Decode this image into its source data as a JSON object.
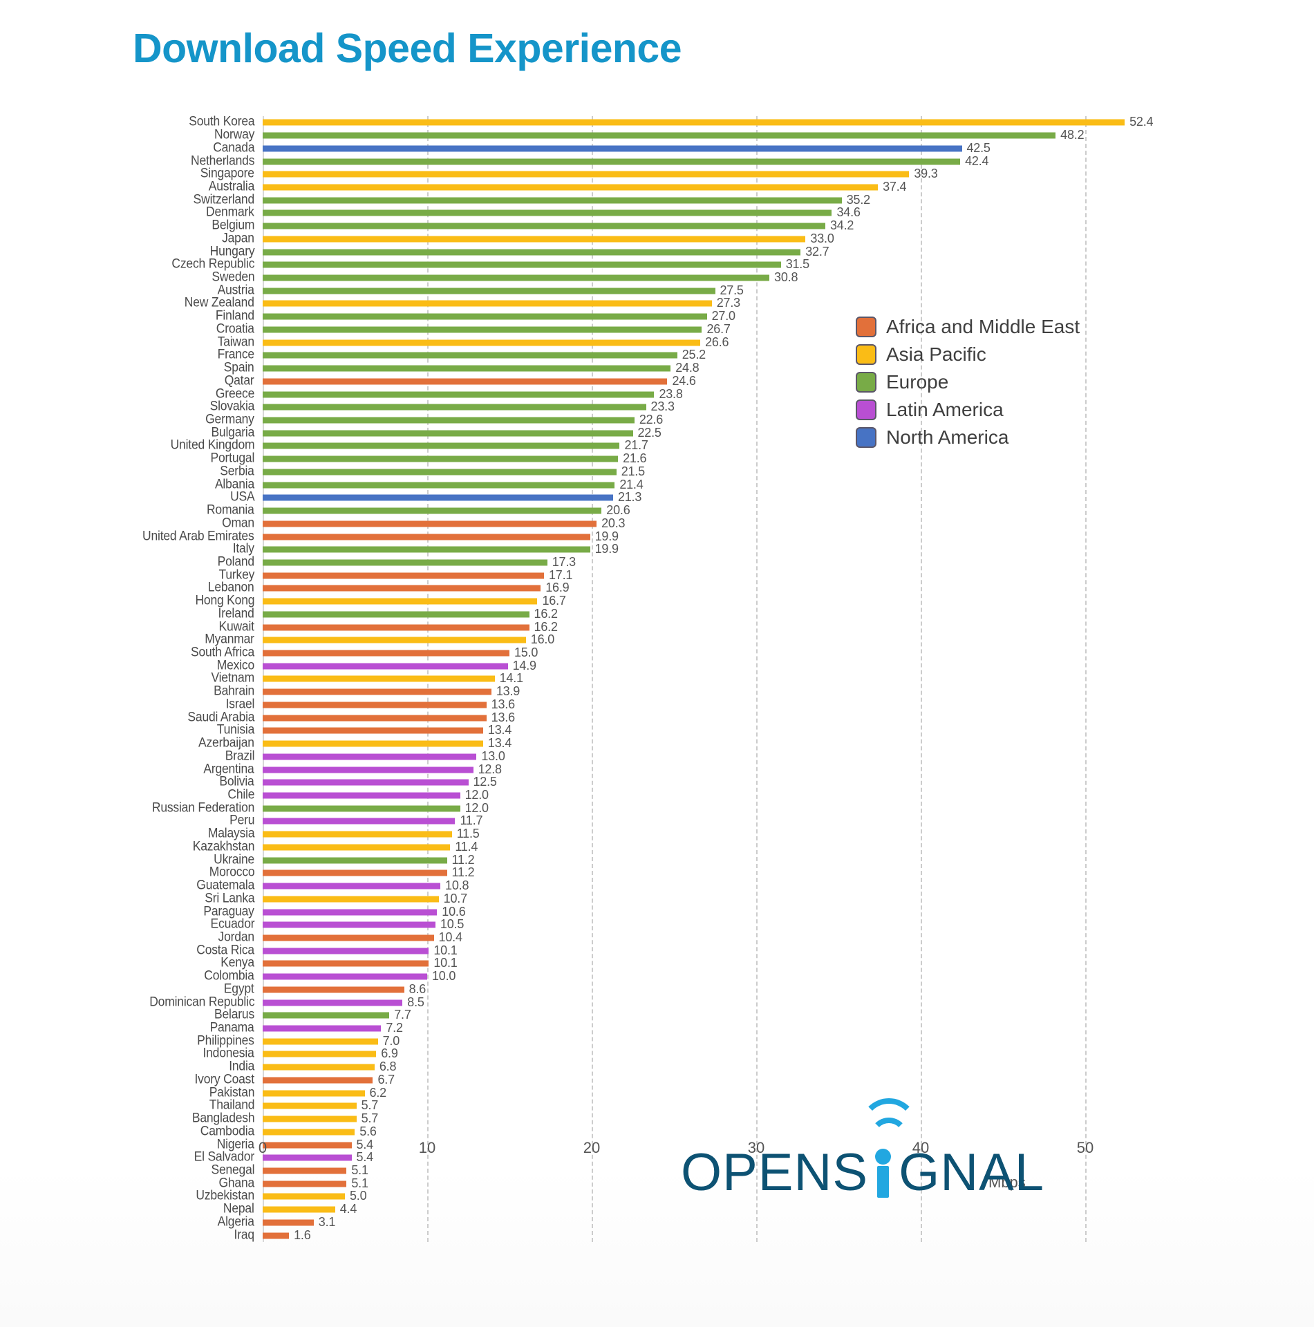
{
  "title": "Download Speed Experience",
  "axis": {
    "unit_label": "Mbps",
    "ticks": [
      0,
      10,
      20,
      30,
      40,
      50
    ],
    "max": 50
  },
  "legend": {
    "items": [
      {
        "label": "Africa and Middle East",
        "color": "#E2703A"
      },
      {
        "label": "Asia Pacific",
        "color": "#FABC16"
      },
      {
        "label": "Europe",
        "color": "#78AB47"
      },
      {
        "label": "Latin America",
        "color": "#B94FD3"
      },
      {
        "label": "North America",
        "color": "#4773C4"
      }
    ]
  },
  "logo": {
    "part1": "OPENS",
    "part2": "GNAL",
    "brand_dark": "#0d5273",
    "brand_light": "#22a7e0"
  },
  "chart_data": {
    "type": "bar",
    "orientation": "horizontal",
    "title": "Download Speed Experience",
    "xlabel": "Mbps",
    "ylabel": "",
    "xlim": [
      0,
      50
    ],
    "grid": "vertical-dashed",
    "legend_position": "right-middle",
    "legend_entries": [
      "Africa and Middle East",
      "Asia Pacific",
      "Europe",
      "Latin America",
      "North America"
    ],
    "region_colors": {
      "Africa and Middle East": "#E2703A",
      "Asia Pacific": "#FABC16",
      "Europe": "#78AB47",
      "Latin America": "#B94FD3",
      "North America": "#4773C4"
    },
    "categories": [
      "South Korea",
      "Norway",
      "Canada",
      "Netherlands",
      "Singapore",
      "Australia",
      "Switzerland",
      "Denmark",
      "Belgium",
      "Japan",
      "Hungary",
      "Czech Republic",
      "Sweden",
      "Austria",
      "New Zealand",
      "Finland",
      "Croatia",
      "Taiwan",
      "France",
      "Spain",
      "Qatar",
      "Greece",
      "Slovakia",
      "Germany",
      "Bulgaria",
      "United Kingdom",
      "Portugal",
      "Serbia",
      "Albania",
      "USA",
      "Romania",
      "Oman",
      "United Arab Emirates",
      "Italy",
      "Poland",
      "Turkey",
      "Lebanon",
      "Hong Kong",
      "Ireland",
      "Kuwait",
      "Myanmar",
      "South Africa",
      "Mexico",
      "Vietnam",
      "Bahrain",
      "Israel",
      "Saudi Arabia",
      "Tunisia",
      "Azerbaijan",
      "Brazil",
      "Argentina",
      "Bolivia",
      "Chile",
      "Russian Federation",
      "Peru",
      "Malaysia",
      "Kazakhstan",
      "Ukraine",
      "Morocco",
      "Guatemala",
      "Sri Lanka",
      "Paraguay",
      "Ecuador",
      "Jordan",
      "Costa Rica",
      "Kenya",
      "Colombia",
      "Egypt",
      "Dominican Republic",
      "Belarus",
      "Panama",
      "Philippines",
      "Indonesia",
      "India",
      "Ivory Coast",
      "Pakistan",
      "Thailand",
      "Bangladesh",
      "Cambodia",
      "Nigeria",
      "El Salvador",
      "Senegal",
      "Ghana",
      "Uzbekistan",
      "Nepal",
      "Algeria",
      "Iraq"
    ],
    "values": [
      52.4,
      48.2,
      42.5,
      42.4,
      39.3,
      37.4,
      35.2,
      34.6,
      34.2,
      33.0,
      32.7,
      31.5,
      30.8,
      27.5,
      27.3,
      27.0,
      26.7,
      26.6,
      25.2,
      24.8,
      24.6,
      23.8,
      23.3,
      22.6,
      22.5,
      21.7,
      21.6,
      21.5,
      21.4,
      21.3,
      20.6,
      20.3,
      19.9,
      19.9,
      17.3,
      17.1,
      16.9,
      16.7,
      16.2,
      16.2,
      16.0,
      15.0,
      14.9,
      14.1,
      13.9,
      13.6,
      13.6,
      13.4,
      13.4,
      13.0,
      12.8,
      12.5,
      12.0,
      12.0,
      11.7,
      11.5,
      11.4,
      11.2,
      11.2,
      10.8,
      10.7,
      10.6,
      10.5,
      10.4,
      10.1,
      10.1,
      10.0,
      8.6,
      8.5,
      7.7,
      7.2,
      7.0,
      6.9,
      6.8,
      6.7,
      6.2,
      5.7,
      5.7,
      5.6,
      5.4,
      5.4,
      5.1,
      5.1,
      5.0,
      4.4,
      3.1,
      1.6
    ],
    "regions": [
      "Asia Pacific",
      "Europe",
      "North America",
      "Europe",
      "Asia Pacific",
      "Asia Pacific",
      "Europe",
      "Europe",
      "Europe",
      "Asia Pacific",
      "Europe",
      "Europe",
      "Europe",
      "Europe",
      "Asia Pacific",
      "Europe",
      "Europe",
      "Asia Pacific",
      "Europe",
      "Europe",
      "Africa and Middle East",
      "Europe",
      "Europe",
      "Europe",
      "Europe",
      "Europe",
      "Europe",
      "Europe",
      "Europe",
      "North America",
      "Europe",
      "Africa and Middle East",
      "Africa and Middle East",
      "Europe",
      "Europe",
      "Africa and Middle East",
      "Africa and Middle East",
      "Asia Pacific",
      "Europe",
      "Africa and Middle East",
      "Asia Pacific",
      "Africa and Middle East",
      "Latin America",
      "Asia Pacific",
      "Africa and Middle East",
      "Africa and Middle East",
      "Africa and Middle East",
      "Africa and Middle East",
      "Asia Pacific",
      "Latin America",
      "Latin America",
      "Latin America",
      "Latin America",
      "Europe",
      "Latin America",
      "Asia Pacific",
      "Asia Pacific",
      "Europe",
      "Africa and Middle East",
      "Latin America",
      "Asia Pacific",
      "Latin America",
      "Latin America",
      "Africa and Middle East",
      "Latin America",
      "Africa and Middle East",
      "Latin America",
      "Africa and Middle East",
      "Latin America",
      "Europe",
      "Latin America",
      "Asia Pacific",
      "Asia Pacific",
      "Asia Pacific",
      "Africa and Middle East",
      "Asia Pacific",
      "Asia Pacific",
      "Asia Pacific",
      "Asia Pacific",
      "Africa and Middle East",
      "Latin America",
      "Africa and Middle East",
      "Africa and Middle East",
      "Asia Pacific",
      "Asia Pacific",
      "Africa and Middle East",
      "Africa and Middle East"
    ],
    "value_labels": [
      "52.4",
      "48.2",
      "42.5",
      "42.4",
      "39.3",
      "37.4",
      "35.2",
      "34.6",
      "34.2",
      "33.0",
      "32.7",
      "31.5",
      "30.8",
      "27.5",
      "27.3",
      "27.0",
      "26.7",
      "26.6",
      "25.2",
      "24.8",
      "24.6",
      "23.8",
      "23.3",
      "22.6",
      "22.5",
      "21.7",
      "21.6",
      "21.5",
      "21.4",
      "21.3",
      "20.6",
      "20.3",
      "19.9",
      "19.9",
      "17.3",
      "17.1",
      "16.9",
      "16.7",
      "16.2",
      "16.2",
      "16.0",
      "15.0",
      "14.9",
      "14.1",
      "13.9",
      "13.6",
      "13.6",
      "13.4",
      "13.4",
      "13.0",
      "12.8",
      "12.5",
      "12.0",
      "12.0",
      "11.7",
      "11.5",
      "11.4",
      "11.2",
      "11.2",
      "10.8",
      "10.7",
      "10.6",
      "10.5",
      "10.4",
      "10.1",
      "10.1",
      "10.0",
      "8.6",
      "8.5",
      "7.7",
      "7.2",
      "7.0",
      "6.9",
      "6.8",
      "6.7",
      "6.2",
      "5.7",
      "5.7",
      "5.6",
      "5.4",
      "5.4",
      "5.1",
      "5.1",
      "5.0",
      "4.4",
      "3.1",
      "1.6"
    ]
  }
}
